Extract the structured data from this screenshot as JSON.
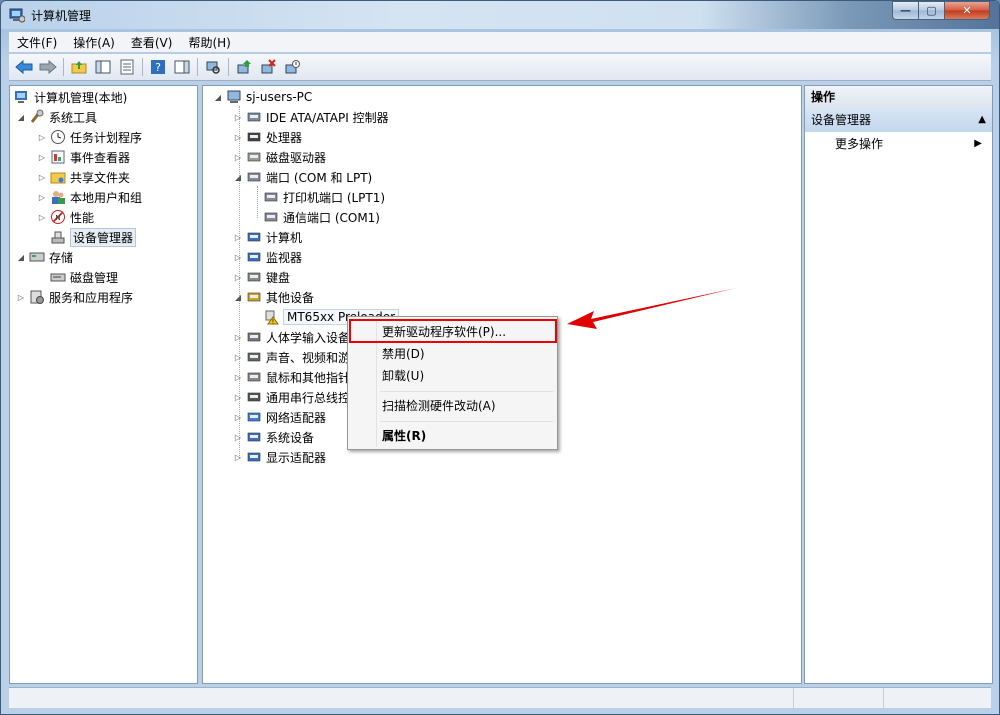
{
  "window": {
    "title": "计算机管理",
    "controls": {
      "minimize": "—",
      "maximize": "▢",
      "close": "✕"
    }
  },
  "menubar": {
    "items": [
      "文件(F)",
      "操作(A)",
      "查看(V)",
      "帮助(H)"
    ]
  },
  "toolbar": {
    "icons": [
      "back-icon",
      "forward-icon",
      "up-folder-icon",
      "show-hide-console-tree-icon",
      "properties-icon",
      "help-icon",
      "show-hide-action-pane-icon",
      "scan-hardware-icon",
      "update-driver-icon",
      "uninstall-icon",
      "disable-icon"
    ]
  },
  "left_tree": {
    "root": "计算机管理(本地)",
    "system_tools": "系统工具",
    "task_scheduler": "任务计划程序",
    "event_viewer": "事件查看器",
    "shared_folders": "共享文件夹",
    "local_users": "本地用户和组",
    "performance": "性能",
    "device_manager": "设备管理器",
    "storage": "存储",
    "disk_management": "磁盘管理",
    "services_apps": "服务和应用程序"
  },
  "device_tree": {
    "computer": "sj-users-PC",
    "categories": [
      {
        "label": "IDE ATA/ATAPI 控制器",
        "icon": "ide-controller-icon"
      },
      {
        "label": "处理器",
        "icon": "processor-icon"
      },
      {
        "label": "磁盘驱动器",
        "icon": "disk-drive-icon"
      },
      {
        "label": "端口 (COM 和 LPT)",
        "icon": "port-icon"
      },
      {
        "label": "计算机",
        "icon": "computer-icon"
      },
      {
        "label": "监视器",
        "icon": "monitor-icon"
      },
      {
        "label": "键盘",
        "icon": "keyboard-icon"
      },
      {
        "label": "其他设备",
        "icon": "other-devices-icon"
      },
      {
        "label": "人体学输入设备",
        "icon": "hid-icon"
      },
      {
        "label": "声音、视频和游",
        "icon": "sound-icon"
      },
      {
        "label": "鼠标和其他指针",
        "icon": "mouse-icon"
      },
      {
        "label": "通用串行总线控",
        "icon": "usb-icon"
      },
      {
        "label": "网络适配器",
        "icon": "network-adapter-icon"
      },
      {
        "label": "系统设备",
        "icon": "system-devices-icon"
      },
      {
        "label": "显示适配器",
        "icon": "display-adapter-icon"
      }
    ],
    "port_children": [
      "打印机端口 (LPT1)",
      "通信端口 (COM1)"
    ],
    "other_child": "MT65xx Preloader"
  },
  "context_menu": {
    "update_driver": "更新驱动程序软件(P)...",
    "disable": "禁用(D)",
    "uninstall": "卸载(U)",
    "scan": "扫描检测硬件改动(A)",
    "properties": "属性(R)"
  },
  "actions_pane": {
    "header": "操作",
    "group": "设备管理器",
    "more": "更多操作"
  },
  "colors": {
    "highlight": "#e00000",
    "arrow": "#e00000"
  }
}
